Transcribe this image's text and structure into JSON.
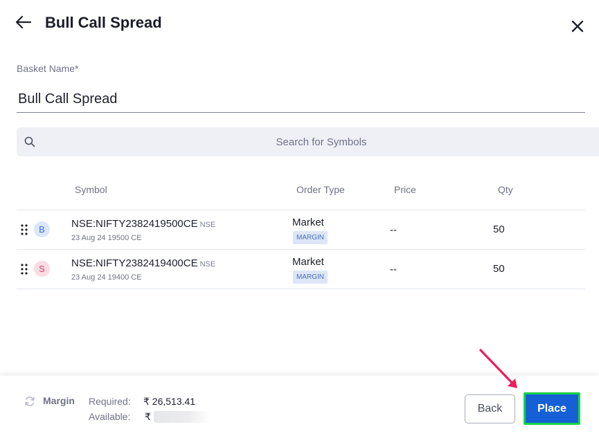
{
  "header": {
    "title": "Bull Call Spread"
  },
  "basket": {
    "label": "Basket Name*",
    "value": "Bull Call Spread"
  },
  "search": {
    "placeholder": "Search for Symbols"
  },
  "table": {
    "columns": [
      "Symbol",
      "Order Type",
      "Price",
      "Qty"
    ],
    "rows": [
      {
        "side": "B",
        "symbol": "NSE:NIFTY2382419500CE",
        "exchange": "NSE",
        "description": "23 Aug 24 19500 CE",
        "order_type": "Market",
        "product": "MARGIN",
        "price": "--",
        "qty": "50"
      },
      {
        "side": "S",
        "symbol": "NSE:NIFTY2382419400CE",
        "exchange": "NSE",
        "description": "23 Aug 24 19400 CE",
        "order_type": "Market",
        "product": "MARGIN",
        "price": "--",
        "qty": "50"
      }
    ]
  },
  "footer": {
    "margin_label": "Margin",
    "required_label": "Required:",
    "required_value": "₹ 26,513.41",
    "available_label": "Available:",
    "available_value": "₹",
    "back_label": "Back",
    "place_label": "Place"
  },
  "icons": {
    "back": "arrow-left-icon",
    "close": "close-icon",
    "search": "search-icon",
    "drag": "drag-handle-icon",
    "refresh": "refresh-icon",
    "annotation": "annotation-arrow"
  },
  "colors": {
    "primary": "#1560d4",
    "place_border": "#17d34a",
    "buy_badge": "#3a6fd8",
    "sell_badge": "#d8456f",
    "annotation_arrow": "#ee1c5c"
  }
}
